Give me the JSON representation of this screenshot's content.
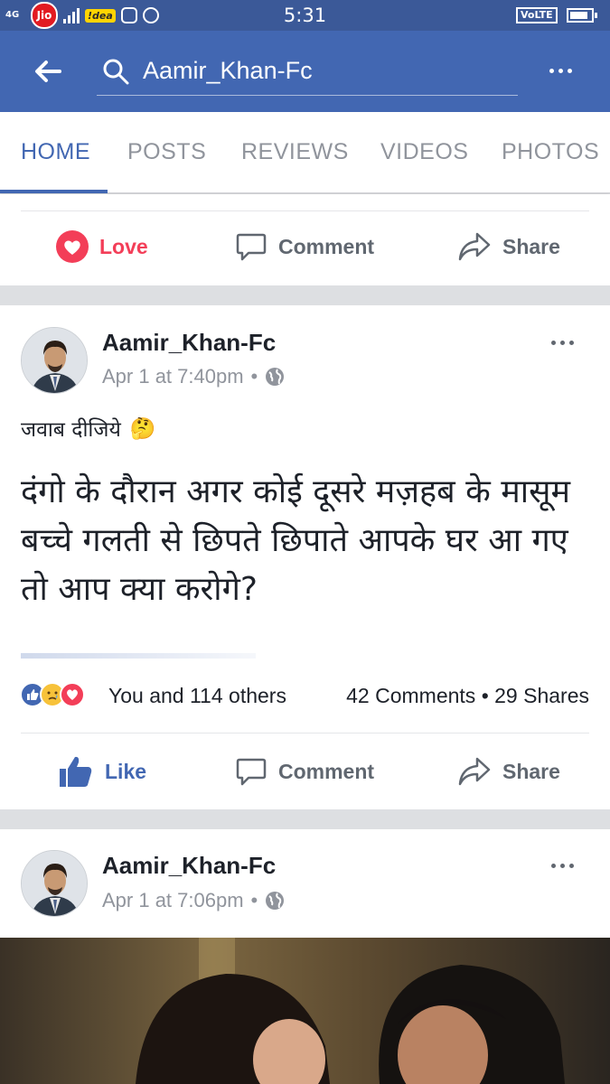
{
  "status_bar": {
    "network_type": "4G",
    "carrier_1": "Jio",
    "carrier_2": "!dea",
    "time": "5:31",
    "volte": "VoLTE",
    "icons": [
      "jio-logo-icon",
      "signal-icon",
      "idea-logo-icon",
      "instagram-icon",
      "whatsapp-icon",
      "battery-icon"
    ],
    "battery_level": 0.85
  },
  "app_bar": {
    "search_text": "Aamir_Khan-Fc",
    "icons": [
      "back-arrow-icon",
      "search-icon",
      "more-icon"
    ],
    "color": "#4267b2"
  },
  "tabs": [
    {
      "label": "HOME",
      "active": true
    },
    {
      "label": "POSTS",
      "active": false
    },
    {
      "label": "REVIEWS",
      "active": false
    },
    {
      "label": "VIDEOS",
      "active": false
    },
    {
      "label": "PHOTOS",
      "active": false
    }
  ],
  "prev_post_actions": {
    "love_label": "Love",
    "comment_label": "Comment",
    "share_label": "Share",
    "love_color": "#f33e58"
  },
  "post1": {
    "author": "Aamir_Khan-Fc",
    "time": "Apr 1 at 7:40pm",
    "separator": "•",
    "caption": "जवाब दीजिये",
    "caption_emoji": "🤔",
    "body": "दंगो के दौरान अगर कोई दूसरे मज़हब के मासूम बच्चे गलती से छिपते छिपाते आपके घर आ गए तो आप क्या करोगे?",
    "reactions_text": "You and 114 others",
    "counts_text": "42 Comments • 29 Shares",
    "like_label": "Like",
    "comment_label": "Comment",
    "share_label": "Share",
    "like_color": "#4267b2"
  },
  "post2": {
    "author": "Aamir_Khan-Fc",
    "time": "Apr 1 at 7:06pm",
    "separator": "•"
  }
}
